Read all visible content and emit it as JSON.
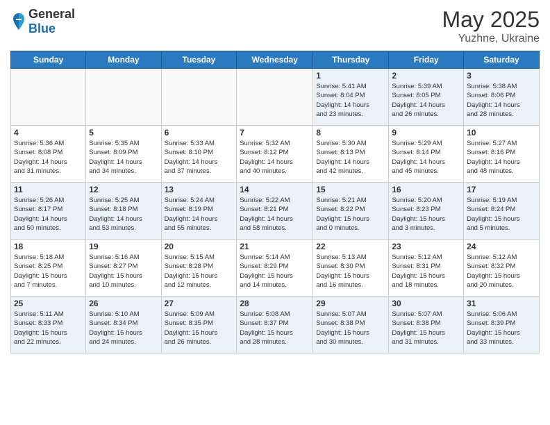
{
  "header": {
    "logo": {
      "general": "General",
      "blue": "Blue"
    },
    "title": "May 2025",
    "location": "Yuzhne, Ukraine"
  },
  "days_of_week": [
    "Sunday",
    "Monday",
    "Tuesday",
    "Wednesday",
    "Thursday",
    "Friday",
    "Saturday"
  ],
  "weeks": [
    [
      {
        "day": "",
        "info": ""
      },
      {
        "day": "",
        "info": ""
      },
      {
        "day": "",
        "info": ""
      },
      {
        "day": "",
        "info": ""
      },
      {
        "day": "1",
        "info": "Sunrise: 5:41 AM\nSunset: 8:04 PM\nDaylight: 14 hours\nand 23 minutes."
      },
      {
        "day": "2",
        "info": "Sunrise: 5:39 AM\nSunset: 8:05 PM\nDaylight: 14 hours\nand 26 minutes."
      },
      {
        "day": "3",
        "info": "Sunrise: 5:38 AM\nSunset: 8:06 PM\nDaylight: 14 hours\nand 28 minutes."
      }
    ],
    [
      {
        "day": "4",
        "info": "Sunrise: 5:36 AM\nSunset: 8:08 PM\nDaylight: 14 hours\nand 31 minutes."
      },
      {
        "day": "5",
        "info": "Sunrise: 5:35 AM\nSunset: 8:09 PM\nDaylight: 14 hours\nand 34 minutes."
      },
      {
        "day": "6",
        "info": "Sunrise: 5:33 AM\nSunset: 8:10 PM\nDaylight: 14 hours\nand 37 minutes."
      },
      {
        "day": "7",
        "info": "Sunrise: 5:32 AM\nSunset: 8:12 PM\nDaylight: 14 hours\nand 40 minutes."
      },
      {
        "day": "8",
        "info": "Sunrise: 5:30 AM\nSunset: 8:13 PM\nDaylight: 14 hours\nand 42 minutes."
      },
      {
        "day": "9",
        "info": "Sunrise: 5:29 AM\nSunset: 8:14 PM\nDaylight: 14 hours\nand 45 minutes."
      },
      {
        "day": "10",
        "info": "Sunrise: 5:27 AM\nSunset: 8:16 PM\nDaylight: 14 hours\nand 48 minutes."
      }
    ],
    [
      {
        "day": "11",
        "info": "Sunrise: 5:26 AM\nSunset: 8:17 PM\nDaylight: 14 hours\nand 50 minutes."
      },
      {
        "day": "12",
        "info": "Sunrise: 5:25 AM\nSunset: 8:18 PM\nDaylight: 14 hours\nand 53 minutes."
      },
      {
        "day": "13",
        "info": "Sunrise: 5:24 AM\nSunset: 8:19 PM\nDaylight: 14 hours\nand 55 minutes."
      },
      {
        "day": "14",
        "info": "Sunrise: 5:22 AM\nSunset: 8:21 PM\nDaylight: 14 hours\nand 58 minutes."
      },
      {
        "day": "15",
        "info": "Sunrise: 5:21 AM\nSunset: 8:22 PM\nDaylight: 15 hours\nand 0 minutes."
      },
      {
        "day": "16",
        "info": "Sunrise: 5:20 AM\nSunset: 8:23 PM\nDaylight: 15 hours\nand 3 minutes."
      },
      {
        "day": "17",
        "info": "Sunrise: 5:19 AM\nSunset: 8:24 PM\nDaylight: 15 hours\nand 5 minutes."
      }
    ],
    [
      {
        "day": "18",
        "info": "Sunrise: 5:18 AM\nSunset: 8:25 PM\nDaylight: 15 hours\nand 7 minutes."
      },
      {
        "day": "19",
        "info": "Sunrise: 5:16 AM\nSunset: 8:27 PM\nDaylight: 15 hours\nand 10 minutes."
      },
      {
        "day": "20",
        "info": "Sunrise: 5:15 AM\nSunset: 8:28 PM\nDaylight: 15 hours\nand 12 minutes."
      },
      {
        "day": "21",
        "info": "Sunrise: 5:14 AM\nSunset: 8:29 PM\nDaylight: 15 hours\nand 14 minutes."
      },
      {
        "day": "22",
        "info": "Sunrise: 5:13 AM\nSunset: 8:30 PM\nDaylight: 15 hours\nand 16 minutes."
      },
      {
        "day": "23",
        "info": "Sunrise: 5:12 AM\nSunset: 8:31 PM\nDaylight: 15 hours\nand 18 minutes."
      },
      {
        "day": "24",
        "info": "Sunrise: 5:12 AM\nSunset: 8:32 PM\nDaylight: 15 hours\nand 20 minutes."
      }
    ],
    [
      {
        "day": "25",
        "info": "Sunrise: 5:11 AM\nSunset: 8:33 PM\nDaylight: 15 hours\nand 22 minutes."
      },
      {
        "day": "26",
        "info": "Sunrise: 5:10 AM\nSunset: 8:34 PM\nDaylight: 15 hours\nand 24 minutes."
      },
      {
        "day": "27",
        "info": "Sunrise: 5:09 AM\nSunset: 8:35 PM\nDaylight: 15 hours\nand 26 minutes."
      },
      {
        "day": "28",
        "info": "Sunrise: 5:08 AM\nSunset: 8:37 PM\nDaylight: 15 hours\nand 28 minutes."
      },
      {
        "day": "29",
        "info": "Sunrise: 5:07 AM\nSunset: 8:38 PM\nDaylight: 15 hours\nand 30 minutes."
      },
      {
        "day": "30",
        "info": "Sunrise: 5:07 AM\nSunset: 8:38 PM\nDaylight: 15 hours\nand 31 minutes."
      },
      {
        "day": "31",
        "info": "Sunrise: 5:06 AM\nSunset: 8:39 PM\nDaylight: 15 hours\nand 33 minutes."
      }
    ]
  ]
}
